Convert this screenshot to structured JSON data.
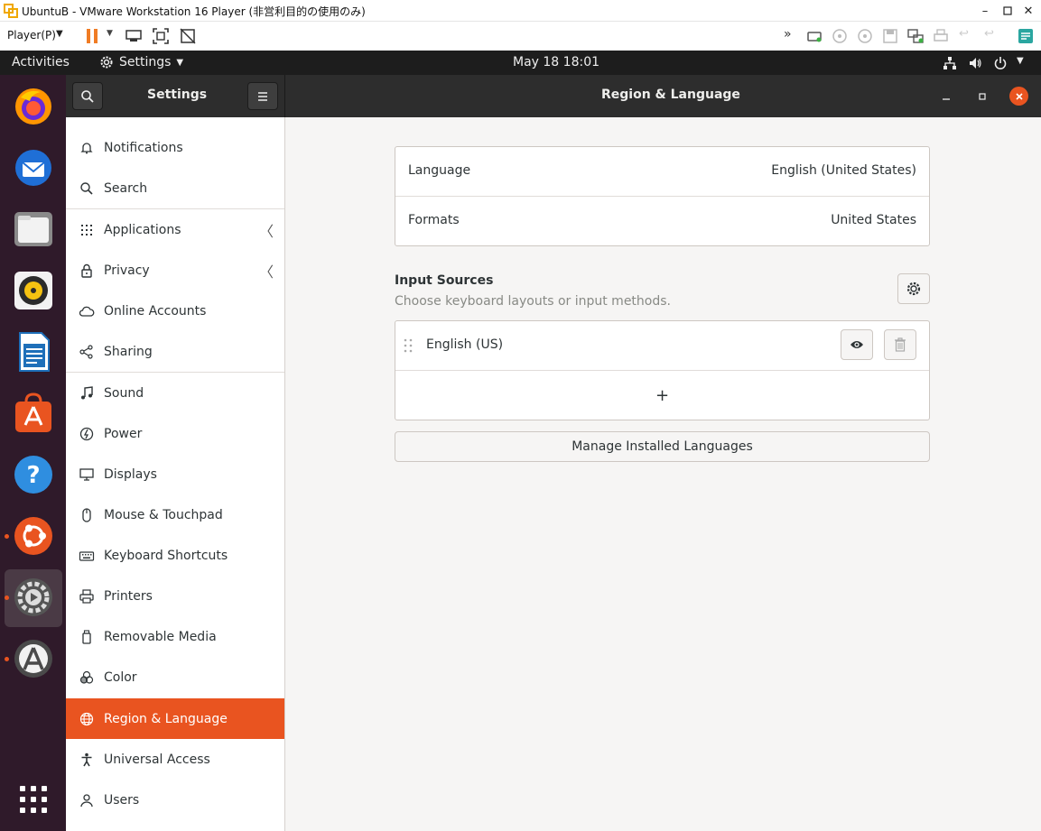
{
  "vmware": {
    "title": "UbuntuB - VMware Workstation 16 Player (非営利目的の使用のみ)",
    "player_menu": "Player(P)",
    "colors": {
      "pause": "#f07c24"
    }
  },
  "topbar": {
    "activities": "Activities",
    "app_menu": "Settings",
    "clock": "May 18  18:01"
  },
  "dock": {
    "items": [
      "firefox-icon",
      "thunderbird-icon",
      "files-icon",
      "rhythmbox-icon",
      "libreoffice-writer-icon",
      "ubuntu-software-icon",
      "help-icon",
      "ubuntu-icon",
      "settings-icon",
      "software-updater-icon",
      "show-apps-icon"
    ]
  },
  "header": {
    "sidebar_title": "Settings",
    "panel_title": "Region & Language"
  },
  "sidebar": {
    "items": [
      {
        "label": "Notifications"
      },
      {
        "label": "Search"
      },
      {
        "label": "Applications"
      },
      {
        "label": "Privacy"
      },
      {
        "label": "Online Accounts"
      },
      {
        "label": "Sharing"
      },
      {
        "label": "Sound"
      },
      {
        "label": "Power"
      },
      {
        "label": "Displays"
      },
      {
        "label": "Mouse & Touchpad"
      },
      {
        "label": "Keyboard Shortcuts"
      },
      {
        "label": "Printers"
      },
      {
        "label": "Removable Media"
      },
      {
        "label": "Color"
      },
      {
        "label": "Region & Language"
      },
      {
        "label": "Universal Access"
      },
      {
        "label": "Users"
      }
    ],
    "active": "Region & Language"
  },
  "main": {
    "language_label": "Language",
    "language_value": "English (United States)",
    "formats_label": "Formats",
    "formats_value": "United States",
    "input_sources_title": "Input Sources",
    "input_sources_subtitle": "Choose keyboard layouts or input methods.",
    "input_sources": [
      {
        "name": "English (US)"
      }
    ],
    "add_symbol": "+",
    "manage_button": "Manage Installed Languages"
  },
  "colors": {
    "accent": "#e95420",
    "header_bg": "#2d2d2d",
    "dock_bg": "#2f1a2a",
    "topbar_bg": "#1d1d1d"
  }
}
